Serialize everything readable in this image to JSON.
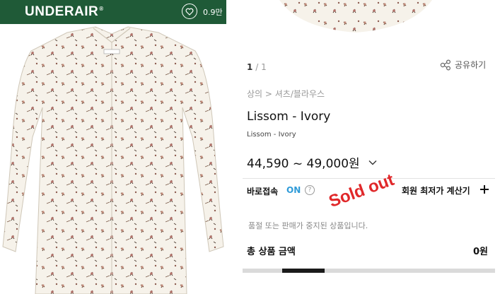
{
  "header": {
    "brand": "UNDERAIR",
    "brand_mark": "®",
    "like_count": "0.9만",
    "background": "#1f5a37"
  },
  "gallery": {
    "page_current": "1",
    "page_separator": "/",
    "page_total": "1"
  },
  "share": {
    "label": "공유하기",
    "icon": "share-icon"
  },
  "product": {
    "breadcrumb": "상의 > 셔츠/블라우스",
    "name": "Lissom - Ivory",
    "subname": "Lissom - Ivory",
    "price": "44,590 ~ 49,000원"
  },
  "direct_access": {
    "label": "바로접속",
    "status": "ON",
    "help": "?",
    "status_color": "#2f9bd8"
  },
  "member_price": {
    "label": "회원 최저가 계산기"
  },
  "notice": "품절 또는 판매가 중지된 상품입니다.",
  "stamp": {
    "text": "Sold out",
    "color": "#e0282a"
  },
  "total": {
    "label": "총 상품 금액",
    "value": "0원"
  },
  "scroll": {
    "position_fraction": 0.16
  }
}
